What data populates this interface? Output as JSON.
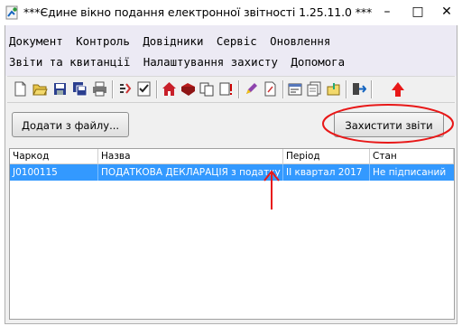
{
  "window": {
    "title": "***Єдине вікно подання електронної звітності 1.25.11.0 ***",
    "minimize_glyph": "–",
    "maximize_glyph": "□",
    "close_glyph": "✕"
  },
  "menu": {
    "row1": [
      "Документ",
      "Контроль",
      "Довідники",
      "Сервіс",
      "Оновлення"
    ],
    "row2": [
      "Звіти та квитанції",
      "Налаштування захисту",
      "Допомога"
    ]
  },
  "toolbar": {
    "icons": [
      "new-document-icon",
      "open-folder-icon",
      "save-icon",
      "save-all-icon",
      "print-icon",
      "fields-icon",
      "check-list-icon",
      "home-icon",
      "books-icon",
      "copy-icon",
      "document-info-icon",
      "pen-icon",
      "document-icon",
      "properties-icon",
      "export-icon",
      "import-icon",
      "exit-icon"
    ],
    "annotation_color": "#e81818"
  },
  "actions": {
    "add_from_file": "Додати з файлу...",
    "protect_reports": "Захистити звіти"
  },
  "table": {
    "columns": [
      "Чаркод",
      "Назва",
      "Період",
      "Стан"
    ],
    "rows": [
      {
        "code": "J0100115",
        "name": "ПОДАТКОВА ДЕКЛАРАЦІЯ з податку ...",
        "period": "II квартал 2017",
        "status": "Не підписаний"
      }
    ],
    "selection_color": "#3399ff"
  }
}
